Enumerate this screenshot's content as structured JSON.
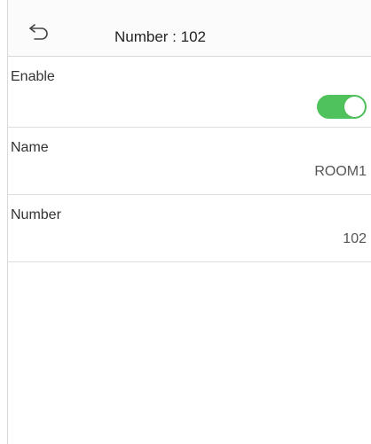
{
  "header": {
    "title": "Number : 102"
  },
  "settings": {
    "enable": {
      "label": "Enable",
      "enabled": true
    },
    "name": {
      "label": "Name",
      "value": "ROOM1"
    },
    "number": {
      "label": "Number",
      "value": "102"
    }
  },
  "colors": {
    "toggle_on": "#4fc25b",
    "divider": "#dddddd"
  }
}
